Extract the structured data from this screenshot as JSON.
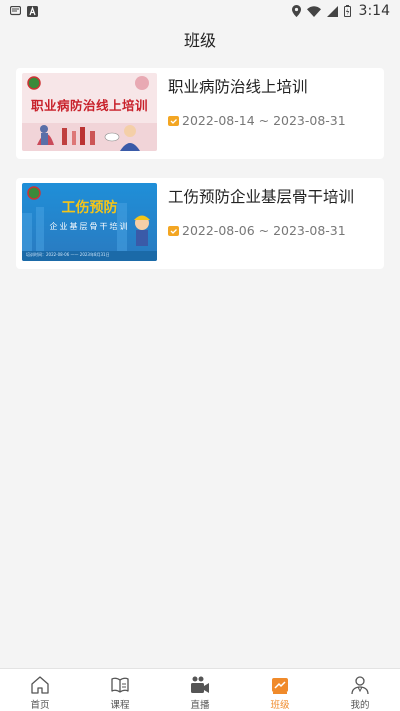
{
  "status_bar": {
    "time": "3:14"
  },
  "header": {
    "title": "班级"
  },
  "classes": [
    {
      "title": "职业病防治线上培训",
      "thumb_text": "职业病防治线上培训",
      "date_range": "2022-08-14 ~ 2023-08-31"
    },
    {
      "title": "工伤预防企业基层骨干培训",
      "thumb_text": "工伤预防",
      "thumb_subtext": "企业基层骨干培训",
      "thumb_footer": "培训时间：2022-08-06 —— 2023年8月31日",
      "date_range": "2022-08-06 ~ 2023-08-31"
    }
  ],
  "bottom_nav": {
    "items": [
      {
        "label": "首页",
        "icon": "home-icon"
      },
      {
        "label": "课程",
        "icon": "book-icon"
      },
      {
        "label": "直播",
        "icon": "video-camera-icon"
      },
      {
        "label": "班级",
        "icon": "classroom-icon"
      },
      {
        "label": "我的",
        "icon": "user-icon"
      }
    ],
    "active_index": 3
  },
  "colors": {
    "accent": "#f08a2a",
    "background": "#f4f4f4",
    "card": "#ffffff"
  }
}
